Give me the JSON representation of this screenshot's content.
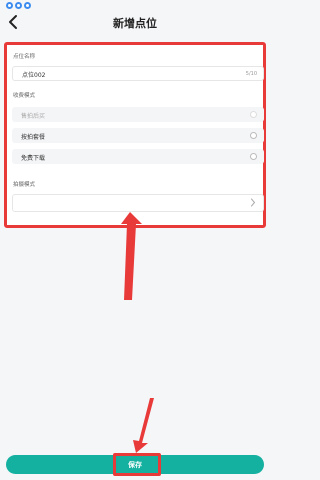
{
  "header": {
    "title": "新增点位"
  },
  "form": {
    "name_label": "点位名称",
    "name_value": "点位002",
    "name_counter": "5/10",
    "charge_label": "收费模式",
    "charge_options": [
      {
        "label": "售拍后买",
        "disabled": true
      },
      {
        "label": "按拍套餐",
        "disabled": false
      },
      {
        "label": "免费下载",
        "disabled": false
      }
    ],
    "shoot_label": "拍摄模式",
    "shoot_value": ""
  },
  "footer": {
    "save_label": "保存"
  },
  "colors": {
    "accent": "#14b0a0",
    "highlight": "#e93a3a"
  },
  "icons": {
    "back": "back-arrow-icon",
    "chevron": "chevron-right-icon"
  }
}
